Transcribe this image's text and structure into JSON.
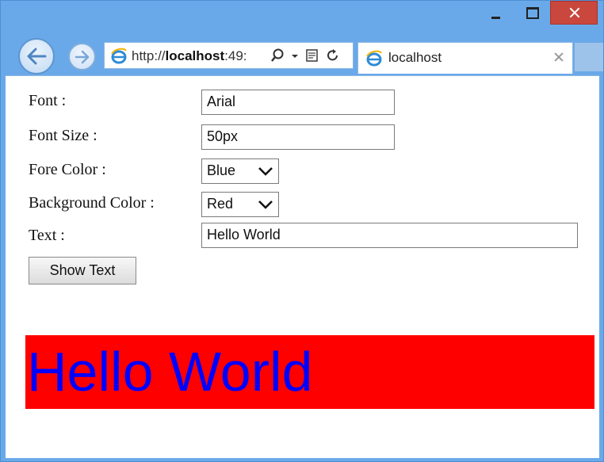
{
  "browser": {
    "url": "http://localhost:49:",
    "url_bold_part": "localhost",
    "tab_title": "localhost",
    "icons": {
      "back": "back-arrow-icon",
      "forward": "forward-arrow-icon",
      "page": "ie-page-icon",
      "search": "search-icon",
      "dropdown": "dropdown-arrow-icon",
      "compat": "compatibility-view-icon",
      "refresh": "refresh-icon",
      "close_tab": "close-icon",
      "minimize": "minimize-icon",
      "maximize": "maximize-icon",
      "close_window": "close-icon"
    },
    "colors": {
      "frame": "#6aa9e9",
      "close_button": "#c9473d"
    }
  },
  "form": {
    "font_label": "Font :",
    "font_value": "Arial",
    "font_size_label": "Font Size :",
    "font_size_value": "50px",
    "fore_color_label": "Fore Color :",
    "fore_color_value": "Blue",
    "background_color_label": "Background Color :",
    "background_color_value": "Red",
    "text_label": "Text :",
    "text_value": "Hello World",
    "button_label": "Show Text"
  },
  "output": {
    "text": "Hello World",
    "fore_color": "#0000ff",
    "background_color": "#ff0000"
  }
}
